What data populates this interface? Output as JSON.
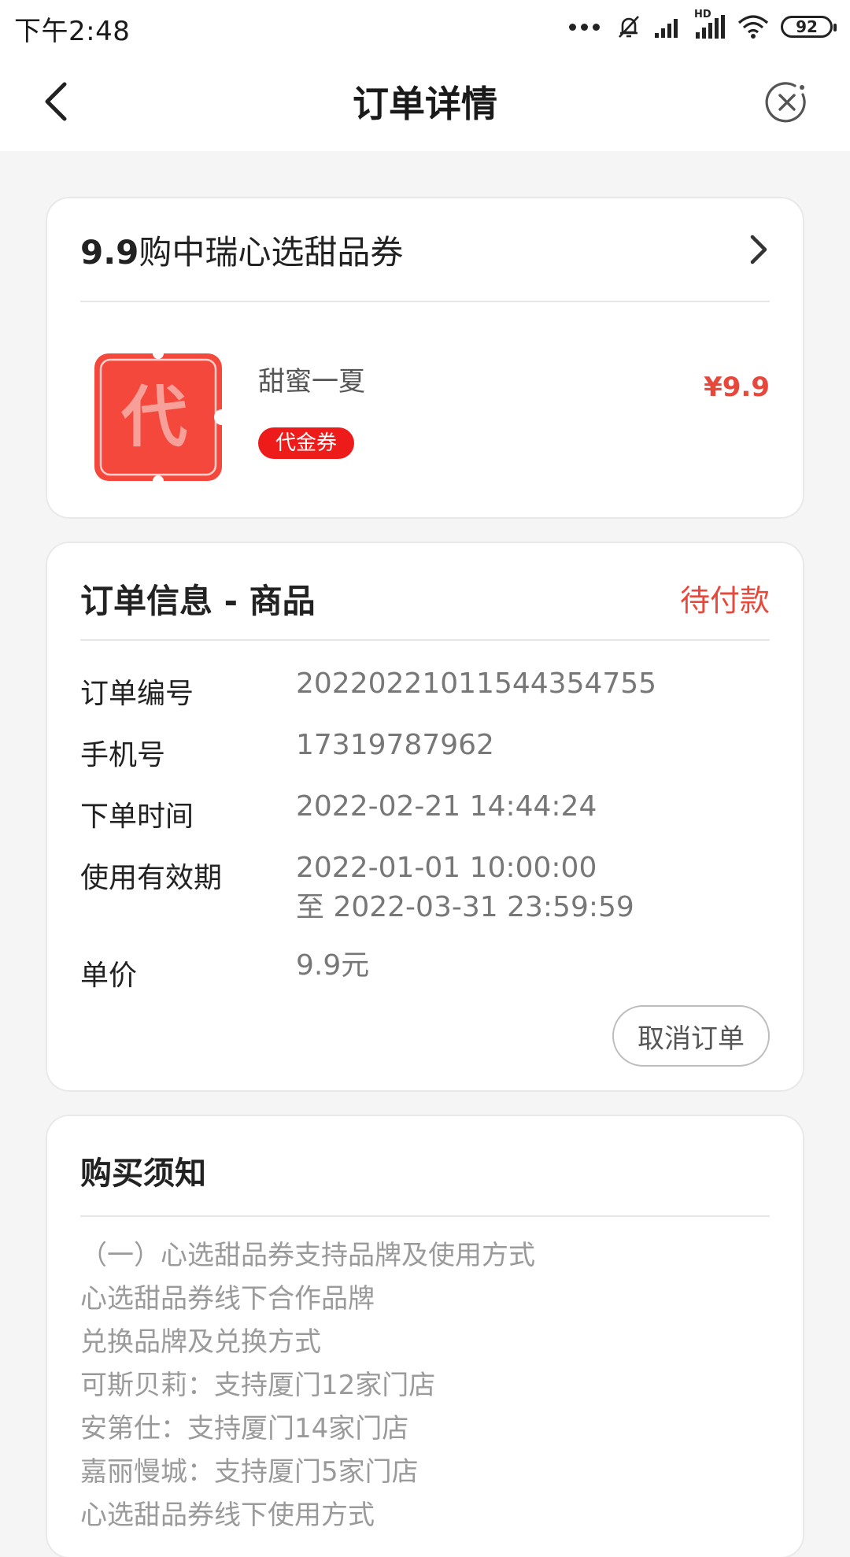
{
  "status_bar": {
    "time": "下午2:48",
    "battery": "92",
    "network": "HD"
  },
  "nav": {
    "title": "订单详情"
  },
  "product": {
    "title_num": "9.9",
    "title_text": "购中瑞心选甜品券",
    "coupon_char": "代",
    "item_name": "甜蜜一夏",
    "tag": "代金券",
    "price": "¥9.9"
  },
  "order": {
    "section_title": "订单信息 - 商品",
    "status": "待付款",
    "rows": [
      {
        "label": "订单编号",
        "value": "20220221011544354755"
      },
      {
        "label": "手机号",
        "value": "17319787962"
      },
      {
        "label": "下单时间",
        "value": "2022-02-21 14:44:24"
      },
      {
        "label": "使用有效期",
        "value": "2022-01-01 10:00:00",
        "value2": "至 2022-03-31 23:59:59"
      },
      {
        "label": "单价",
        "value": "9.9元"
      }
    ],
    "cancel_label": "取消订单"
  },
  "notice": {
    "title": "购买须知",
    "lines": [
      "（一）心选甜品券支持品牌及使用方式",
      "心选甜品券线下合作品牌",
      "兑换品牌及兑换方式",
      "可斯贝莉：支持厦门12家门店",
      "安第仕：支持厦门14家门店",
      "嘉丽慢城：支持厦门5家门店",
      "心选甜品券线下使用方式"
    ]
  },
  "colors": {
    "accent": "#e8483b",
    "tag_bg": "#ee1b1b",
    "coupon_bg": "#f5483d"
  }
}
